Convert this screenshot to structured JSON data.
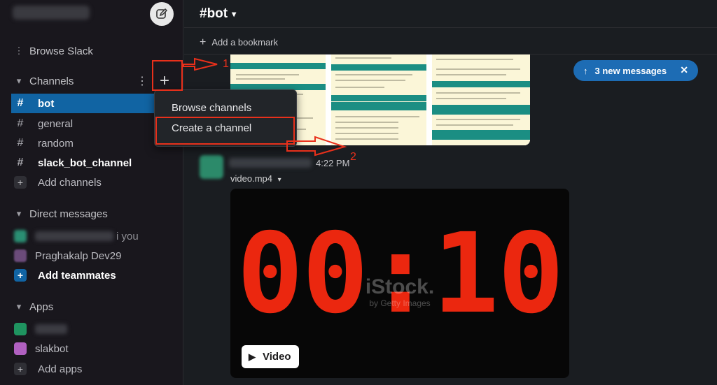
{
  "sidebar": {
    "browse_label": "Browse Slack",
    "channels_label": "Channels",
    "channels": [
      {
        "name": "bot"
      },
      {
        "name": "general"
      },
      {
        "name": "random"
      },
      {
        "name": "slack_bot_channel"
      }
    ],
    "add_channels": "Add channels",
    "direct_messages_label": "Direct messages",
    "dm_you_suffix": "i  you",
    "dm_second": "Praghakalp Dev29",
    "add_teammates": "Add teammates",
    "apps_label": "Apps",
    "apps_second": "slakbot",
    "add_apps": "Add apps"
  },
  "header": {
    "channel_title": "#bot",
    "bookmark_label": "Add a bookmark"
  },
  "new_messages": {
    "label": "3 new messages"
  },
  "message": {
    "time": "4:22 PM",
    "file_label": "video.mp4",
    "video_button": "Video",
    "clock_text": "00:10",
    "watermark": "iStock.",
    "watermark_sub": "by Getty Images"
  },
  "menu": {
    "browse": "Browse channels",
    "create": "Create a channel"
  },
  "annotations": {
    "one": "1",
    "two": "2"
  },
  "colors": {
    "active": "#1164a3",
    "annotation": "#e8301b",
    "new_messages": "#1d6cb4",
    "clock": "#ff2a10"
  }
}
